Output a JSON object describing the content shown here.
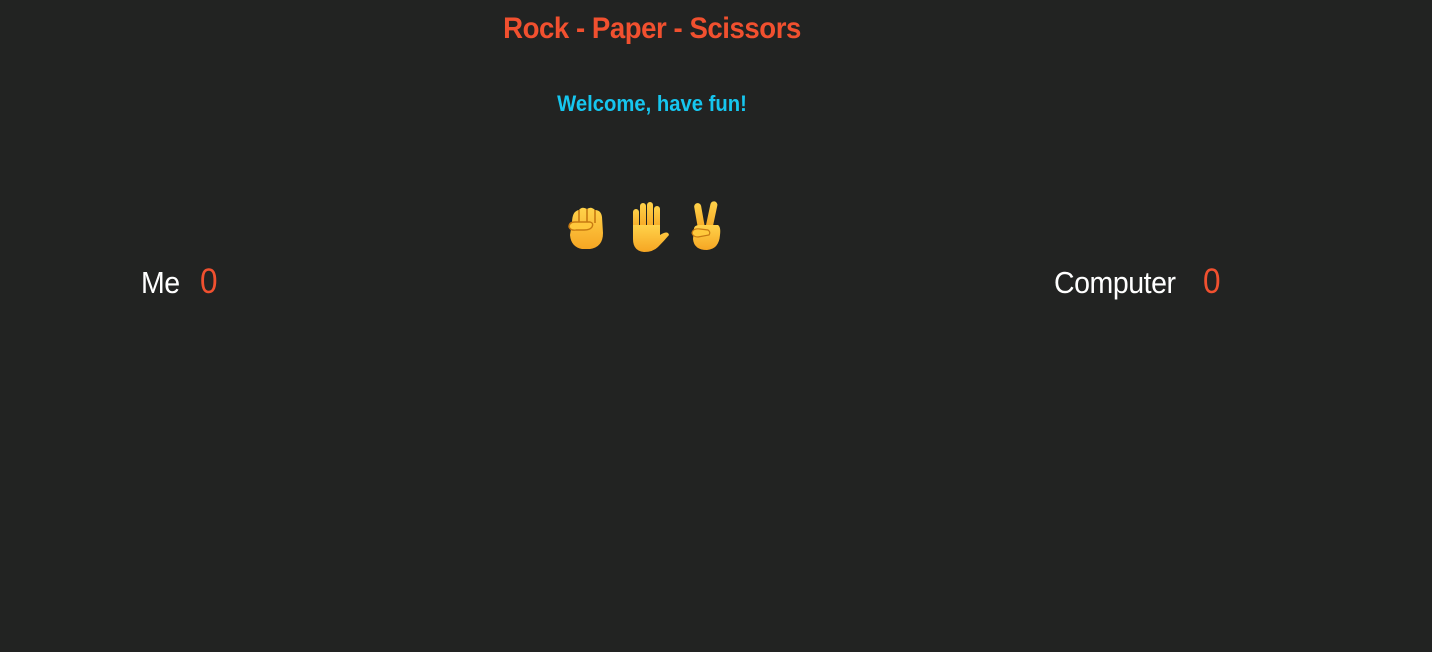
{
  "game": {
    "title": "Rock - Paper - Scissors",
    "message": "Welcome, have fun!",
    "choices": [
      {
        "id": "rock",
        "icon": "raised-fist-icon"
      },
      {
        "id": "paper",
        "icon": "raised-hand-icon"
      },
      {
        "id": "scissors",
        "icon": "victory-hand-icon"
      }
    ]
  },
  "scores": {
    "player": {
      "label": "Me",
      "value": "0"
    },
    "computer": {
      "label": "Computer",
      "value": "0"
    }
  },
  "colors": {
    "background": "#222322",
    "title": "#f1502f",
    "message": "#16c6ef",
    "score_value": "#f1502f",
    "score_label": "#ffffff",
    "hand_skin": "#fbc02d"
  }
}
